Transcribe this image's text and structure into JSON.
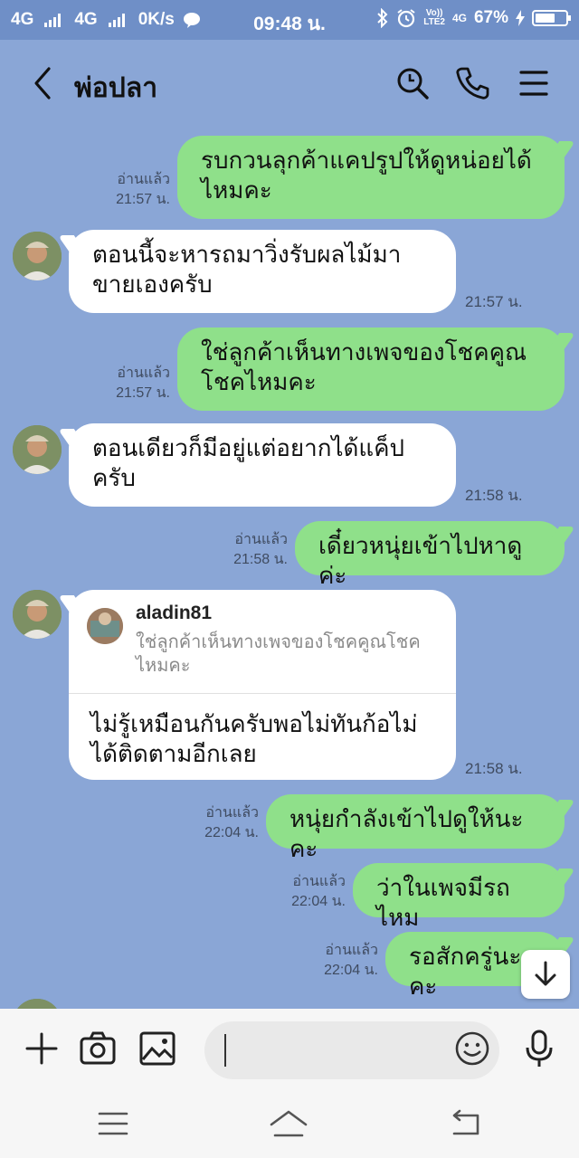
{
  "status_bar": {
    "network1": "4G",
    "network2": "4G",
    "speed": "0K/s",
    "time": "09:48 น.",
    "volte_line1": "Vo))",
    "volte_line2": "LTE2",
    "lte_badge": "4G",
    "battery_percent": "67%",
    "battery_level": 0.67
  },
  "header": {
    "title": "พ่อปลา"
  },
  "messages": [
    {
      "side": "out",
      "text": "รบกวนลุกค้าแคปรูปให้ดูหน่อยได้ไหมคะ",
      "read": "อ่านแล้ว",
      "time": "21:57 น."
    },
    {
      "side": "in",
      "text": "ตอนนี้จะหารถมาวิ่งรับผลไม้มาขายเองครับ",
      "time": "21:57 น."
    },
    {
      "side": "out",
      "text": "ใช่ลูกค้าเห็นทางเพจของโชคคูณโชคไหมคะ",
      "read": "อ่านแล้ว",
      "time": "21:57 น."
    },
    {
      "side": "in",
      "text": "ตอนเดียวก็มีอยู่แต่อยากได้แค็ปครับ",
      "time": "21:58 น."
    },
    {
      "side": "out",
      "text": "เดี๋ยวหนุ่ยเข้าไปหาดูค่ะ",
      "read": "อ่านแล้ว",
      "time": "21:58 น."
    },
    {
      "side": "in",
      "reply_user": "aladin81",
      "reply_quote": "ใช่ลูกค้าเห็นทางเพจของโชคคูณโชคไหมคะ",
      "text": "ไม่รู้เหมือนกันครับพอไม่ทันก้อไม่ได้ติดตามอีกเลย",
      "time": "21:58 น."
    },
    {
      "side": "out",
      "text": "หนุ่ยกำลังเข้าไปดูให้นะคะ",
      "read": "อ่านแล้ว",
      "time": "22:04 น."
    },
    {
      "side": "out",
      "text": "ว่าในเพจมีรถไหม",
      "read": "อ่านแล้ว",
      "time": "22:04 น."
    },
    {
      "side": "out",
      "text": "รอสักครู่นะคะ",
      "read": "อ่านแล้ว",
      "time": "22:04 น."
    }
  ],
  "input": {
    "value": "",
    "placeholder": ""
  },
  "icons": {
    "back": "chevron-left-icon",
    "search": "search-icon",
    "call": "phone-icon",
    "menu": "menu-icon",
    "plus": "plus-icon",
    "camera": "camera-icon",
    "gallery": "image-icon",
    "emoji": "emoji-icon",
    "mic": "microphone-icon",
    "scroll": "arrow-down-icon"
  },
  "colors": {
    "background": "#8aa6d6",
    "outgoing_bubble": "#8fe08a",
    "incoming_bubble": "#ffffff"
  }
}
